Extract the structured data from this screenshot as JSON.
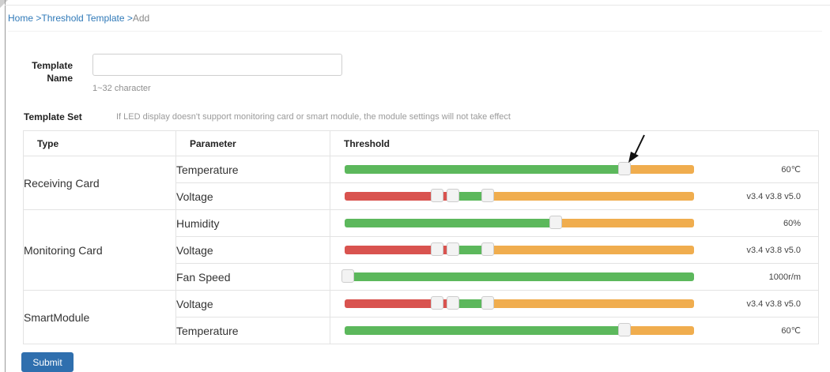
{
  "breadcrumb": {
    "home": "Home",
    "section": "Threshold Template",
    "current": "Add",
    "sep": " >"
  },
  "form": {
    "name_label": "Template Name",
    "name_value": "",
    "name_hint": "1~32 character",
    "set_label": "Template Set",
    "set_note": "If LED display doesn't support monitoring card or smart module, the module settings will not take effect"
  },
  "table": {
    "headers": {
      "type": "Type",
      "parameter": "Parameter",
      "threshold": "Threshold"
    },
    "groups": [
      {
        "type": "Receiving Card",
        "rows": [
          {
            "parameter": "Temperature",
            "value": "60℃"
          },
          {
            "parameter": "Voltage",
            "value": "v3.4 v3.8 v5.0"
          }
        ]
      },
      {
        "type": "Monitoring Card",
        "rows": [
          {
            "parameter": "Humidity",
            "value": "60%"
          },
          {
            "parameter": "Voltage",
            "value": "v3.4 v3.8 v5.0"
          },
          {
            "parameter": "Fan Speed",
            "value": "1000r/m"
          }
        ]
      },
      {
        "type": "SmartModule",
        "rows": [
          {
            "parameter": "Voltage",
            "value": "v3.4 v3.8 v5.0"
          },
          {
            "parameter": "Temperature",
            "value": "60℃"
          }
        ]
      }
    ]
  },
  "sliders": {
    "temp": {
      "green_to": 0.8
    },
    "voltage": {
      "red_to": 0.3,
      "green_to": 0.41,
      "handles": [
        0.265,
        0.31,
        0.41
      ]
    },
    "humidity": {
      "green_to": 0.605
    },
    "fan": {
      "green_to": 1.0,
      "handle": 0.01
    }
  },
  "colors": {
    "green": "#5cb85c",
    "orange": "#f0ad4e",
    "red": "#d9534f",
    "primary": "#2f6fae",
    "link": "#2f79b8"
  },
  "submit_label": "Submit"
}
